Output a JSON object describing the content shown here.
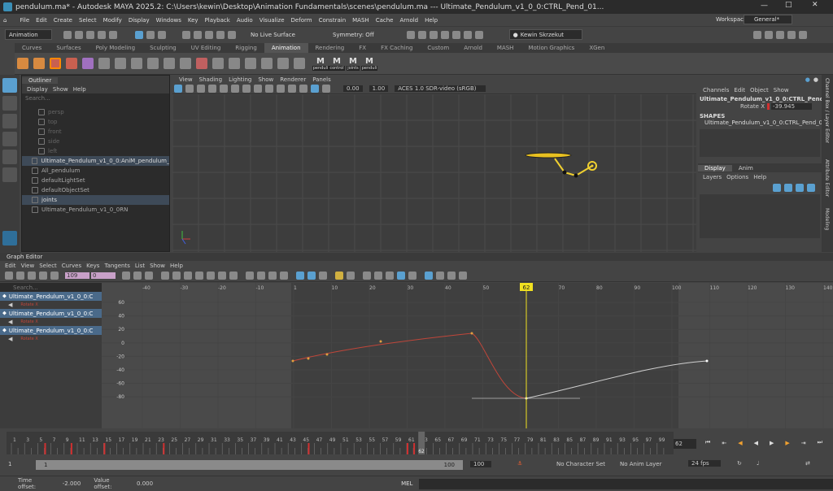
{
  "window": {
    "title": "pendulum.ma* - Autodesk MAYA 2025.2: C:\\Users\\kewin\\Desktop\\Animation Fundamentals\\scenes\\pendulum.ma   ---   Ultimate_Pendulum_v1_0_0:CTRL_Pend_01..."
  },
  "menu": [
    "File",
    "Edit",
    "Create",
    "Select",
    "Modify",
    "Display",
    "Windows",
    "Key",
    "Playback",
    "Audio",
    "Visualize",
    "Deform",
    "Constrain",
    "MASH",
    "Cache",
    "Arnold",
    "Help"
  ],
  "workspace": {
    "label": "Workspace:",
    "value": "General*"
  },
  "status": {
    "mode": "Animation",
    "live": "No Live Surface",
    "symmetry": "Symmetry: Off",
    "user": "Kewin Skrzekut"
  },
  "shelf_tabs": [
    "Curves",
    "Surfaces",
    "Poly Modeling",
    "Sculpting",
    "UV Editing",
    "Rigging",
    "Animation",
    "Rendering",
    "FX",
    "FX Caching",
    "Custom",
    "Arnold",
    "MASH",
    "Motion Graphics",
    "XGen"
  ],
  "shelf_active": "Animation",
  "shelf_labels": [
    "penduli",
    "control",
    "joints",
    "penduli"
  ],
  "outliner": {
    "title": "Outliner",
    "menu": [
      "Display",
      "Show",
      "Help"
    ],
    "search": "Search...",
    "items": [
      "persp",
      "top",
      "front",
      "side",
      "left",
      "Ultimate_Pendulum_v1_0_0:AniM_pendulum_Main",
      "All_pendulum",
      "defaultLightSet",
      "defaultObjectSet",
      "joints",
      "Ultimate_Pendulum_v1_0_0RN"
    ]
  },
  "viewport": {
    "menu": [
      "View",
      "Shading",
      "Lighting",
      "Show",
      "Renderer",
      "Panels"
    ],
    "exposure": "0.00",
    "gamma": "1.00",
    "colorspace": "ACES 1.0 SDR-video (sRGB)"
  },
  "channelbox": {
    "menu": [
      "Channels",
      "Edit",
      "Object",
      "Show"
    ],
    "object": "Ultimate_Pendulum_v1_0_0:CTRL_Pend_01 ...",
    "attr": "Rotate X",
    "value": "-39.945",
    "shapes": "SHAPES",
    "shape": "Ultimate_Pendulum_v1_0_0:CTRL_Pend_01Shape",
    "tabs": [
      "Display",
      "Anim"
    ],
    "layer_menu": [
      "Layers",
      "Options",
      "Help"
    ]
  },
  "side_tabs": [
    "Channel Box / Layer Editor",
    "Attribute Editor",
    "Modeling"
  ],
  "graph_editor": {
    "title": "Graph Editor",
    "menu": [
      "Edit",
      "View",
      "Select",
      "Curves",
      "Keys",
      "Tangents",
      "List",
      "Show",
      "Help"
    ],
    "field1": "109",
    "field2": "0",
    "search": "Search...",
    "curves": [
      {
        "name": "Ultimate_Pendulum_v1_0_0:C",
        "attr": "Rotate X"
      },
      {
        "name": "Ultimate_Pendulum_v1_0_0:C",
        "attr": "Rotate X"
      },
      {
        "name": "Ultimate_Pendulum_v1_0_0:C",
        "attr": "Rotate X"
      }
    ],
    "x_ticks": [
      "-40",
      "-30",
      "-20",
      "-10",
      "1",
      "10",
      "20",
      "30",
      "40",
      "50",
      "62",
      "70",
      "80",
      "90",
      "100",
      "110",
      "120",
      "130",
      "140"
    ],
    "y_ticks": [
      "60",
      "40",
      "20",
      "0",
      "-20",
      "-40",
      "-60",
      "-80"
    ],
    "current_frame": "62"
  },
  "timeline": {
    "ticks": [
      "1",
      "3",
      "5",
      "7",
      "9",
      "11",
      "13",
      "15",
      "17",
      "19",
      "21",
      "23",
      "25",
      "27",
      "29",
      "31",
      "33",
      "35",
      "37",
      "39",
      "41",
      "43",
      "45",
      "47",
      "49",
      "51",
      "53",
      "55",
      "57",
      "59",
      "61",
      "63",
      "65",
      "67",
      "69",
      "71",
      "73",
      "75",
      "77",
      "79",
      "81",
      "83",
      "85",
      "87",
      "89",
      "91",
      "93",
      "95",
      "97",
      "99"
    ],
    "current": "62",
    "frame_field": "62"
  },
  "range": {
    "start": "1",
    "inner_start": "1",
    "inner_end": "100",
    "end": "100",
    "character": "No Character Set",
    "anim_layer": "No Anim Layer",
    "fps": "24 fps"
  },
  "cmdline": {
    "time_offset_label": "Time offset:",
    "time_offset": "-2.000",
    "value_offset_label": "Value offset:",
    "value_offset": "0.000",
    "lang": "MEL"
  },
  "colors": {
    "accent": "#5aa0d0",
    "curve_red": "#c0463a",
    "curve_white": "#cfcfcf",
    "current_time": "#f0e020"
  }
}
